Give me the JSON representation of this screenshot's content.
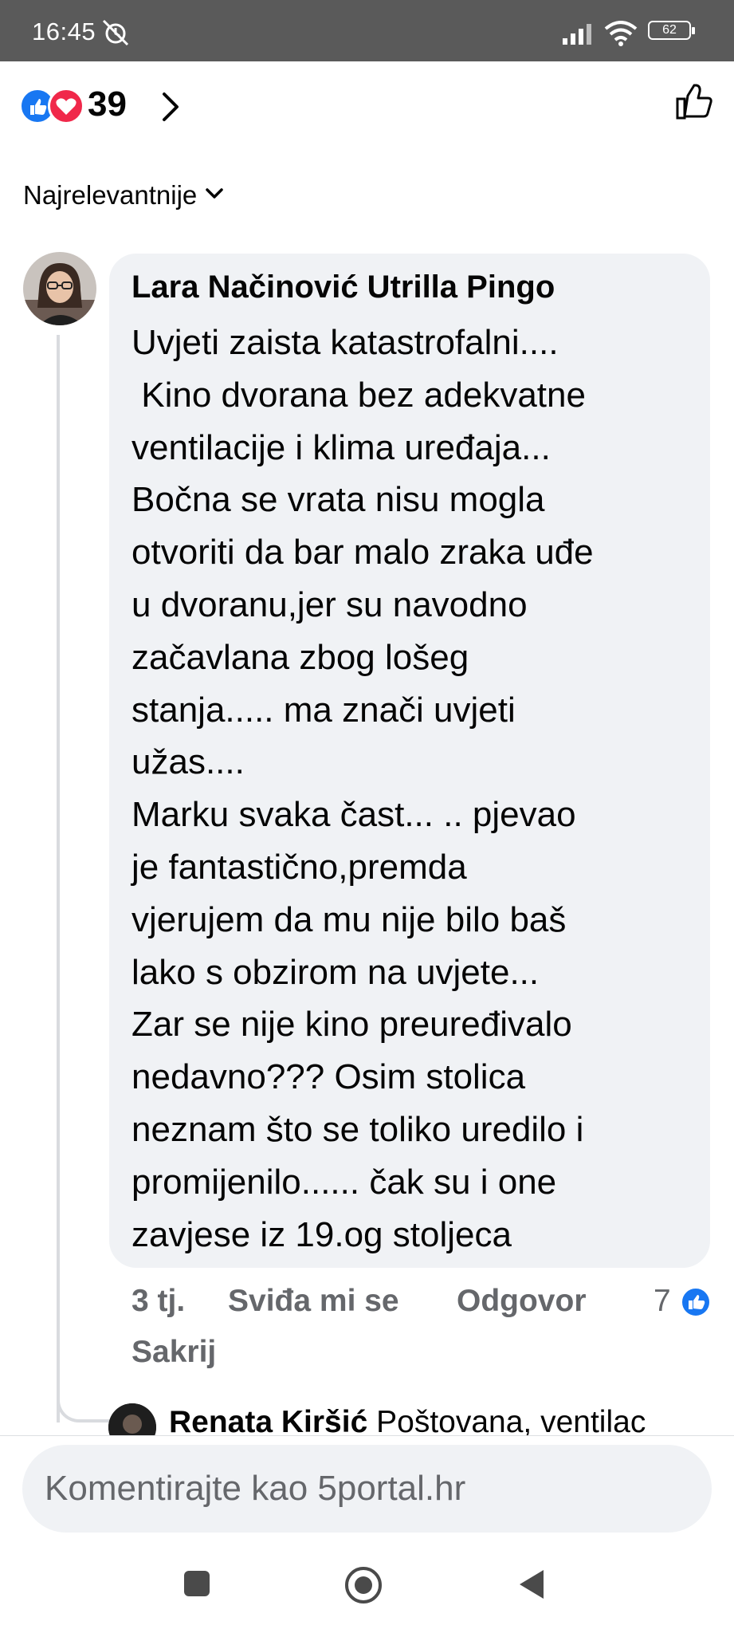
{
  "status_bar": {
    "time": "16:45",
    "battery": "62"
  },
  "reactions": {
    "count": "39",
    "types": [
      "like-icon",
      "love-icon"
    ],
    "like_color": "#1877f2",
    "love_color": "#f0284a"
  },
  "sort": {
    "label": "Najrelevantnije"
  },
  "comment": {
    "author": "Lara Načinović Utrilla Pingo",
    "lines": [
      "Uvjeti zaista katastrofalni....",
      " Kino dvorana bez adekvatne",
      "ventilacije i klima uređaja...",
      "Bočna se vrata nisu mogla",
      "otvoriti da bar malo zraka uđe",
      "u dvoranu,jer su navodno",
      "začavlana zbog lošeg",
      "stanja..... ma znači uvjeti",
      "užas....",
      "Marku svaka čast... .. pjevao",
      "je fantastično,premda",
      "vjerujem da mu nije bilo baš",
      "lako s obzirom na uvjete...",
      "Zar se nije kino preuređivalo",
      "nedavno??? Osim stolica",
      "neznam što se toliko uredilo i",
      "promijenilo...... čak su i one",
      "zavjese iz 19.og stoljeca"
    ],
    "time": "3 tj.",
    "like_action": "Sviđa mi se",
    "reply_action": "Odgovor",
    "like_count": "7",
    "hide_action": "Sakrij"
  },
  "reply": {
    "author": "Renata Kiršić",
    "preview": "Poštovana, ventilac"
  },
  "composer": {
    "placeholder": "Komentirajte kao 5portal.hr"
  },
  "colors": {
    "accent": "#1877f2",
    "secondary_text": "#65676b",
    "bubble": "#f0f2f5"
  }
}
